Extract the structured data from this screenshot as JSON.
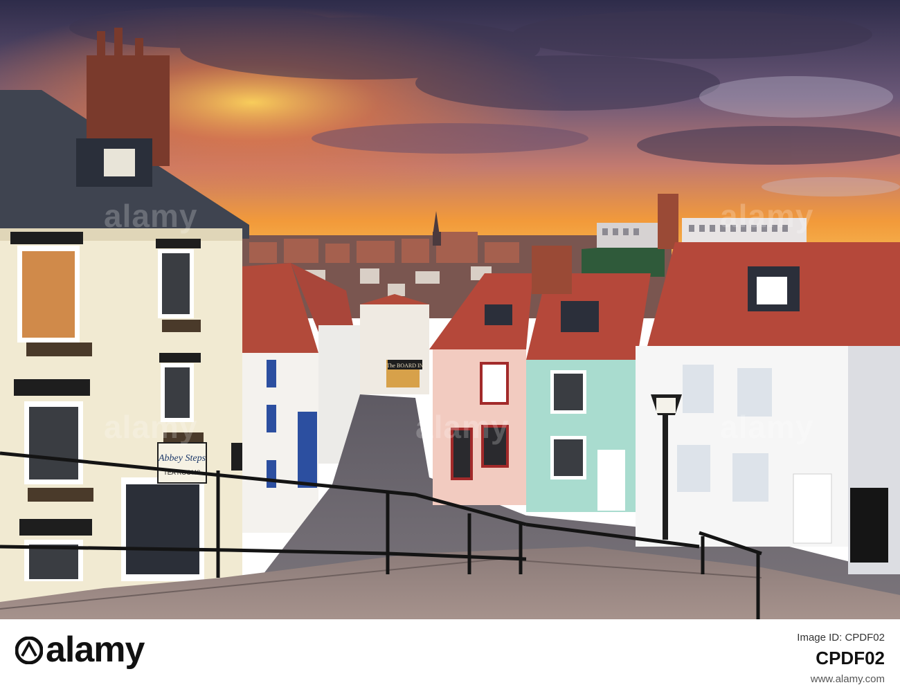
{
  "photo": {
    "sign_abbey_steps": "Abbey Steps",
    "sign_tea_rooms": "TEA ROOMS",
    "sign_pub": "The BOARD IN"
  },
  "watermark": {
    "word": "alamy"
  },
  "footer": {
    "logo_text": "alamy",
    "image_id_label": "Image ID: CPDF02",
    "image_id": "CPDF02",
    "url": "www.alamy.com"
  },
  "colors": {
    "sky_top": "#3d3a5c",
    "sunset": "#f2a23a",
    "roof_red": "#b5483a",
    "cobble": "#6e6a70"
  }
}
